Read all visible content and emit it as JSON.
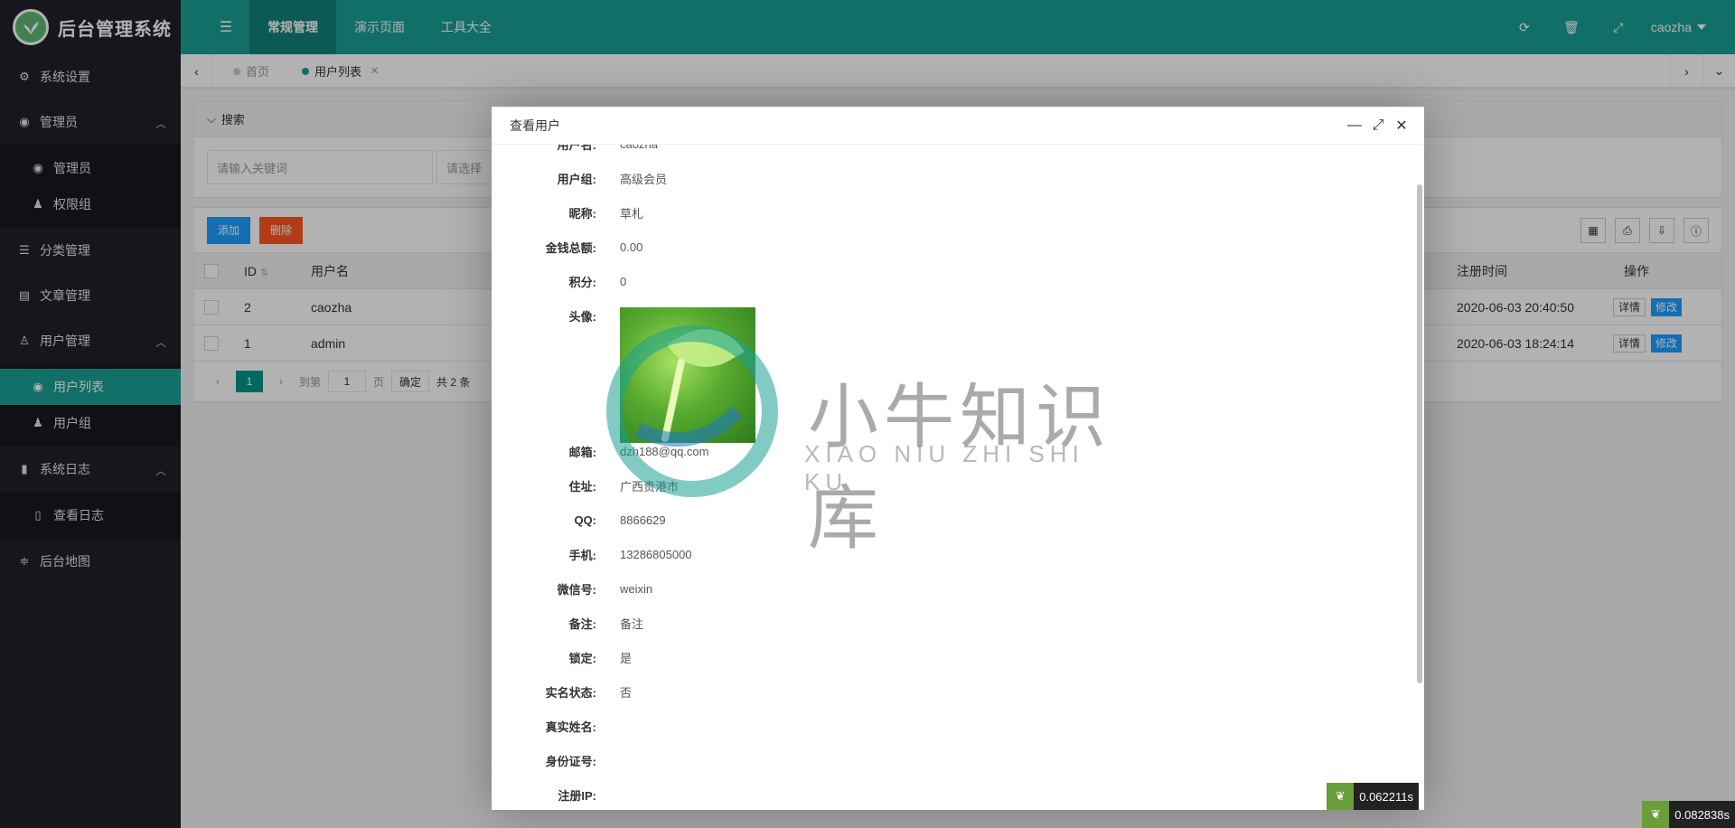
{
  "app": {
    "title": "后台管理系统"
  },
  "sidebar": {
    "items": [
      {
        "label": "系统设置",
        "icon": "gears-icon"
      },
      {
        "label": "管理员",
        "icon": "user-circle-icon",
        "children": [
          {
            "label": "管理员",
            "icon": "user-circle-icon"
          },
          {
            "label": "权限组",
            "icon": "users-icon"
          }
        ]
      },
      {
        "label": "分类管理",
        "icon": "list-icon"
      },
      {
        "label": "文章管理",
        "icon": "newspaper-icon"
      },
      {
        "label": "用户管理",
        "icon": "user-icon",
        "children": [
          {
            "label": "用户列表",
            "icon": "user-circle-icon",
            "active": true
          },
          {
            "label": "用户组",
            "icon": "users-icon"
          }
        ]
      },
      {
        "label": "系统日志",
        "icon": "file-icon",
        "children": [
          {
            "label": "查看日志",
            "icon": "file-text-icon"
          }
        ]
      },
      {
        "label": "后台地图",
        "icon": "sitemap-icon"
      }
    ]
  },
  "header": {
    "tabs": [
      "常规管理",
      "演示页面",
      "工具大全"
    ],
    "active_tab": 0,
    "user": "caozha"
  },
  "tabbar": {
    "tabs": [
      {
        "label": "首页"
      },
      {
        "label": "用户列表",
        "active": true
      }
    ]
  },
  "search": {
    "title": "搜索",
    "keyword_placeholder": "请输入关键词",
    "select_placeholder": "请选择"
  },
  "table": {
    "buttons": {
      "add": "添加",
      "delete": "删除"
    },
    "headers": {
      "id": "ID",
      "username": "用户名",
      "reg_time": "注册时间",
      "op": "操作"
    },
    "rows": [
      {
        "id": "2",
        "username": "caozha",
        "reg_time": "2020-06-03 20:40:50"
      },
      {
        "id": "1",
        "username": "admin",
        "reg_time": "2020-06-03 18:24:14"
      }
    ],
    "row_buttons": {
      "detail": "详情",
      "edit": "修改"
    },
    "pager": {
      "current": "1",
      "goto": "到第",
      "page_value": "1",
      "page_unit": "页",
      "confirm": "确定",
      "total": "共 2 条"
    }
  },
  "modal": {
    "title": "查看用户",
    "fields": [
      {
        "label": "用户名:",
        "value": "caozha"
      },
      {
        "label": "用户组:",
        "value": "高级会员"
      },
      {
        "label": "昵称:",
        "value": "草札"
      },
      {
        "label": "金钱总额:",
        "value": "0.00"
      },
      {
        "label": "积分:",
        "value": "0"
      }
    ],
    "avatar_label": "头像:",
    "fields2": [
      {
        "label": "邮箱:",
        "value": "dzh188@qq.com"
      },
      {
        "label": "住址:",
        "value": "广西贵港市"
      },
      {
        "label": "QQ:",
        "value": "8866629"
      },
      {
        "label": "手机:",
        "value": "13286805000"
      },
      {
        "label": "微信号:",
        "value": "weixin"
      },
      {
        "label": "备注:",
        "value": "备注"
      },
      {
        "label": "锁定:",
        "value": "是"
      },
      {
        "label": "实名状态:",
        "value": "否"
      },
      {
        "label": "真实姓名:",
        "value": ""
      },
      {
        "label": "身份证号:",
        "value": ""
      },
      {
        "label": "注册IP:",
        "value": ""
      }
    ]
  },
  "watermark": {
    "cn": "小牛知识库",
    "en": "XIAO NIU ZHI SHI KU"
  },
  "timings": {
    "modal": "0.062211s",
    "page": "0.082838s"
  }
}
